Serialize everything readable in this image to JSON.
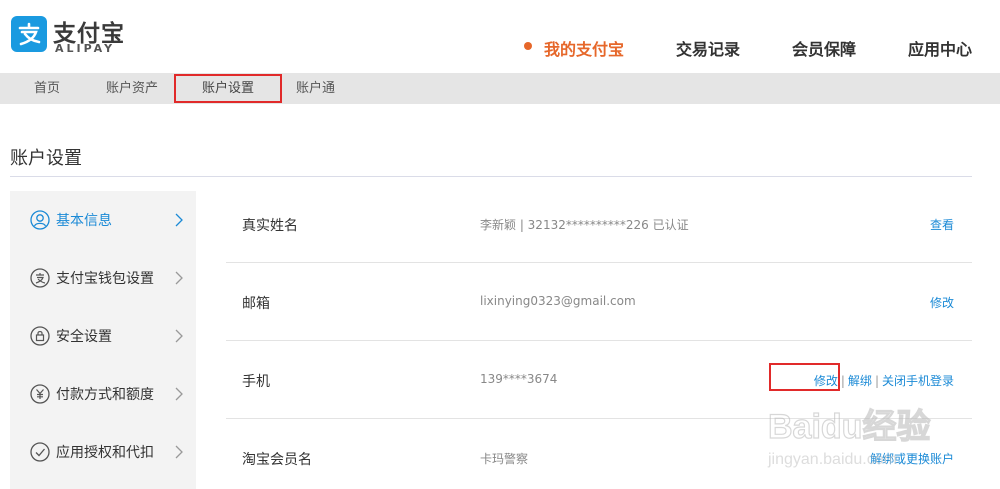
{
  "header": {
    "brand_cn": "支付宝",
    "brand_en": "ALIPAY",
    "nav": [
      {
        "label": "我的支付宝",
        "active": true
      },
      {
        "label": "交易记录",
        "active": false
      },
      {
        "label": "会员保障",
        "active": false
      },
      {
        "label": "应用中心",
        "active": false
      }
    ]
  },
  "subnav": {
    "items": [
      {
        "label": "首页"
      },
      {
        "label": "账户资产"
      },
      {
        "label": "账户设置",
        "selected": true
      },
      {
        "label": "账户通"
      }
    ]
  },
  "page": {
    "title": "账户设置"
  },
  "sidebar": {
    "items": [
      {
        "label": "基本信息",
        "icon": "user-icon",
        "active": true
      },
      {
        "label": "支付宝钱包设置",
        "icon": "wallet-icon"
      },
      {
        "label": "安全设置",
        "icon": "lock-icon"
      },
      {
        "label": "付款方式和额度",
        "icon": "yuan-icon"
      },
      {
        "label": "应用授权和代扣",
        "icon": "check-icon"
      }
    ]
  },
  "rows": [
    {
      "label": "真实姓名",
      "value": "李新颖 | 32132**********226 已认证",
      "actions": [
        "查看"
      ]
    },
    {
      "label": "邮箱",
      "value": "lixinying0323@gmail.com",
      "actions": [
        "修改"
      ]
    },
    {
      "label": "手机",
      "value": "139****3674",
      "actions": [
        "修改",
        "解绑",
        "关闭手机登录"
      ]
    },
    {
      "label": "淘宝会员名",
      "value": "卡玛警察",
      "actions": [
        "解绑或更换账户"
      ]
    }
  ],
  "watermark": {
    "text_top": "Baidu经验",
    "text_bottom": "jingyan.baidu.com"
  },
  "colors": {
    "accent_orange": "#e6672a",
    "link_blue": "#1b8ad6",
    "highlight_red": "#e12a2a",
    "logo_blue": "#1a9ae0"
  }
}
